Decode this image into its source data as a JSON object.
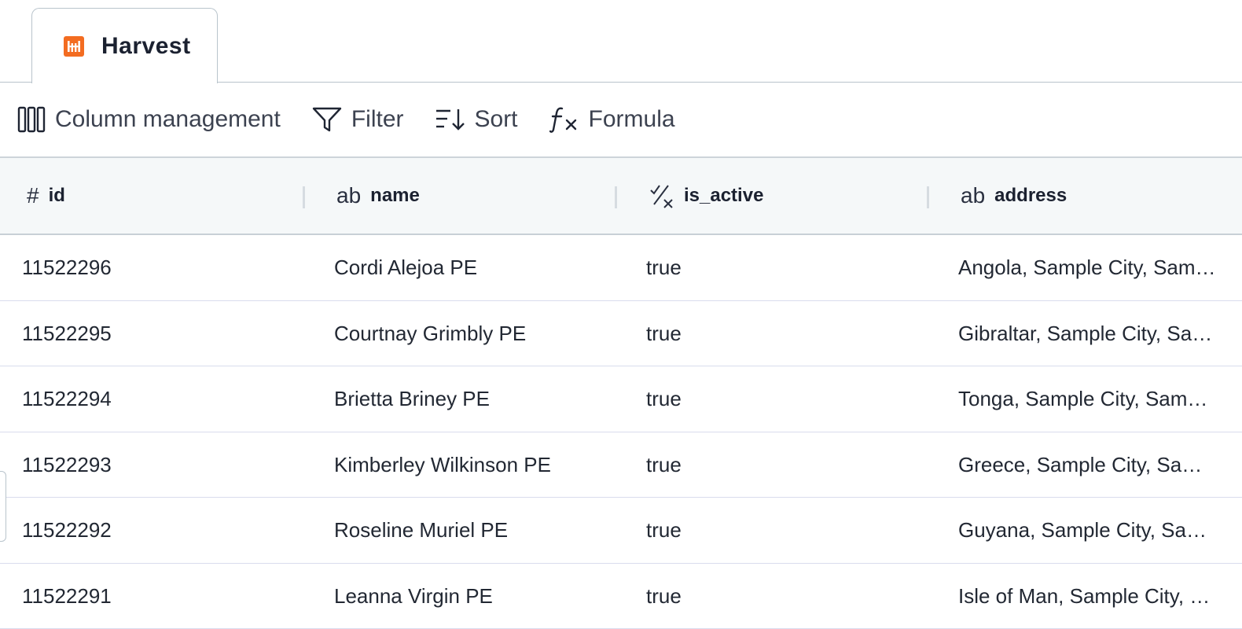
{
  "tab": {
    "label": "Harvest",
    "icon": "harvest-logo-icon",
    "brand_color": "#f36c21"
  },
  "toolbar": {
    "column_management": "Column management",
    "filter": "Filter",
    "sort": "Sort",
    "formula": "Formula"
  },
  "table": {
    "columns": [
      {
        "type_glyph": "#",
        "label": "id"
      },
      {
        "type_glyph": "ab",
        "label": "name"
      },
      {
        "type_glyph": "boolean-icon",
        "label": "is_active"
      },
      {
        "type_glyph": "ab",
        "label": "address"
      }
    ],
    "rows": [
      {
        "id": "11522296",
        "name": "Cordi Alejoa PE",
        "is_active": "true",
        "address": "Angola, Sample City, Sample State"
      },
      {
        "id": "11522295",
        "name": "Courtnay Grimbly PE",
        "is_active": "true",
        "address": "Gibraltar, Sample City, Sample State"
      },
      {
        "id": "11522294",
        "name": "Brietta Briney PE",
        "is_active": "true",
        "address": "Tonga, Sample City, Sample State"
      },
      {
        "id": "11522293",
        "name": "Kimberley Wilkinson PE",
        "is_active": "true",
        "address": "Greece, Sample City, Sample State"
      },
      {
        "id": "11522292",
        "name": "Roseline Muriel PE",
        "is_active": "true",
        "address": "Guyana, Sample City, Sample State"
      },
      {
        "id": "11522291",
        "name": "Leanna Virgin PE",
        "is_active": "true",
        "address": "Isle of Man, Sample City, Sample State"
      }
    ]
  }
}
